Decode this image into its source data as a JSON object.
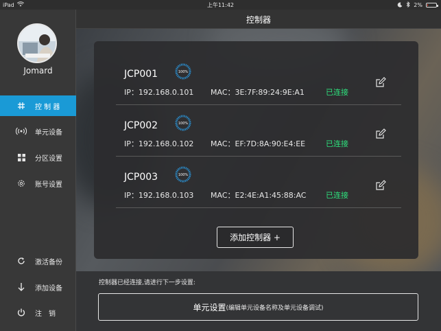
{
  "status_bar": {
    "device": "iPad",
    "time": "上午11:42",
    "battery": "2%",
    "battery_fraction": 0.02,
    "battery_color": "#e04a3a",
    "icons": [
      "wifi-icon",
      "moon-icon",
      "bluetooth-icon",
      "battery-icon"
    ]
  },
  "sidebar": {
    "username": "Jomard",
    "nav": [
      {
        "label": "控 制 器",
        "icon": "controller-icon",
        "active": true
      },
      {
        "label": "单元设备",
        "icon": "signal-icon",
        "active": false
      },
      {
        "label": "分区设置",
        "icon": "grid-icon",
        "active": false
      },
      {
        "label": "账号设置",
        "icon": "gear-icon",
        "active": false
      }
    ],
    "actions": [
      {
        "label": "激活备份",
        "icon": "refresh-icon"
      },
      {
        "label": "添加设备",
        "icon": "arrow-down-icon"
      },
      {
        "label": "注　销",
        "icon": "power-icon"
      }
    ]
  },
  "header": {
    "title": "控制器"
  },
  "controllers": [
    {
      "name": "JCP001",
      "progress": "100%",
      "progress_value": 1.0,
      "ip_label": "IP：",
      "ip": "192.168.0.101",
      "mac_label": "MAC：",
      "mac": "3E:7F:89:24:9E:A1",
      "status": "已连接"
    },
    {
      "name": "JCP002",
      "progress": "100%",
      "progress_value": 1.0,
      "ip_label": "IP：",
      "ip": "192.168.0.102",
      "mac_label": "MAC：",
      "mac": "EF:7D:8A:90:E4:EE",
      "status": "已连接"
    },
    {
      "name": "JCP003",
      "progress": "100%",
      "progress_value": 1.0,
      "ip_label": "IP：",
      "ip": "192.168.0.103",
      "mac_label": "MAC：",
      "mac": "E2:4E:A1:45:88:AC",
      "status": "已连接"
    }
  ],
  "add_controller_button": "添加控制器 +",
  "bottom": {
    "hint": "控制器已经连接,请进行下一步设置:",
    "setup_button_main": "单元设置",
    "setup_button_sub": "(编辑单元设备名称及单元设备调试)"
  },
  "colors": {
    "accent": "#1a9ad6",
    "connected": "#2ee07d",
    "progress_ring": "#2a8fd0"
  }
}
